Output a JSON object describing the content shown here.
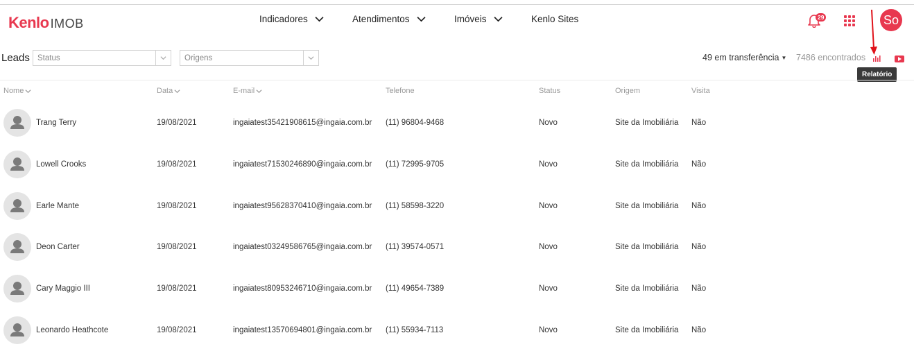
{
  "brand": {
    "name": "Kenlo",
    "product": "IMOB"
  },
  "nav": {
    "items": [
      {
        "label": "Indicadores",
        "has_dropdown": true
      },
      {
        "label": "Atendimentos",
        "has_dropdown": true
      },
      {
        "label": "Imóveis",
        "has_dropdown": true
      },
      {
        "label": "Kenlo Sites",
        "has_dropdown": false
      }
    ]
  },
  "header": {
    "notifications_count": "29",
    "user_initials": "So",
    "accent_color": "#e8384f"
  },
  "filters": {
    "page_title": "Leads",
    "status_placeholder": "Status",
    "origins_placeholder": "Origens",
    "transfer_label": "49 em transferência",
    "found_label": "7486 encontrados",
    "report_tooltip": "Relatório"
  },
  "table": {
    "columns": [
      "Nome",
      "Data",
      "E-mail",
      "Telefone",
      "Status",
      "Origem",
      "Visita"
    ],
    "rows": [
      {
        "name": "Trang Terry",
        "date": "19/08/2021",
        "email": "ingaiatest35421908615@ingaia.com.br",
        "phone": "(11) 96804-9468",
        "status": "Novo",
        "origin": "Site da Imobiliária",
        "visit": "Não"
      },
      {
        "name": "Lowell Crooks",
        "date": "19/08/2021",
        "email": "ingaiatest71530246890@ingaia.com.br",
        "phone": "(11) 72995-9705",
        "status": "Novo",
        "origin": "Site da Imobiliária",
        "visit": "Não"
      },
      {
        "name": "Earle Mante",
        "date": "19/08/2021",
        "email": "ingaiatest95628370410@ingaia.com.br",
        "phone": "(11) 58598-3220",
        "status": "Novo",
        "origin": "Site da Imobiliária",
        "visit": "Não"
      },
      {
        "name": "Deon Carter",
        "date": "19/08/2021",
        "email": "ingaiatest03249586765@ingaia.com.br",
        "phone": "(11) 39574-0571",
        "status": "Novo",
        "origin": "Site da Imobiliária",
        "visit": "Não"
      },
      {
        "name": "Cary Maggio III",
        "date": "19/08/2021",
        "email": "ingaiatest80953246710@ingaia.com.br",
        "phone": "(11) 49654-7389",
        "status": "Novo",
        "origin": "Site da Imobiliária",
        "visit": "Não"
      },
      {
        "name": "Leonardo Heathcote",
        "date": "19/08/2021",
        "email": "ingaiatest13570694801@ingaia.com.br",
        "phone": "(11) 55934-7113",
        "status": "Novo",
        "origin": "Site da Imobiliária",
        "visit": "Não"
      }
    ]
  }
}
